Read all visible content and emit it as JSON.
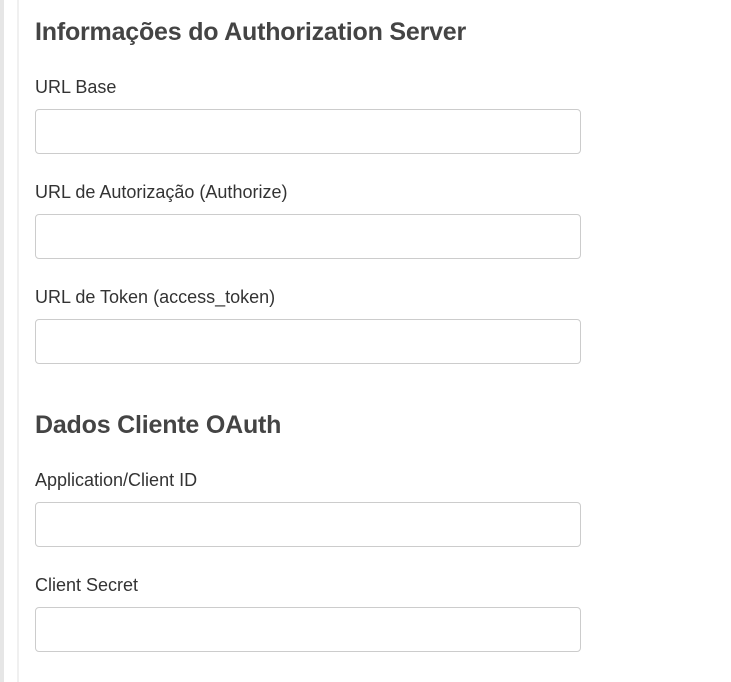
{
  "authorization_server": {
    "title": "Informações do Authorization Server",
    "fields": [
      {
        "label": "URL Base",
        "value": "",
        "placeholder": ""
      },
      {
        "label": "URL de Autorização (Authorize)",
        "value": "",
        "placeholder": ""
      },
      {
        "label": "URL de Token (access_token)",
        "value": "",
        "placeholder": ""
      }
    ]
  },
  "oauth_client": {
    "title": "Dados Cliente OAuth",
    "fields": [
      {
        "label": "Application/Client ID",
        "value": "",
        "placeholder": ""
      },
      {
        "label": "Client Secret",
        "value": "",
        "placeholder": ""
      }
    ]
  }
}
